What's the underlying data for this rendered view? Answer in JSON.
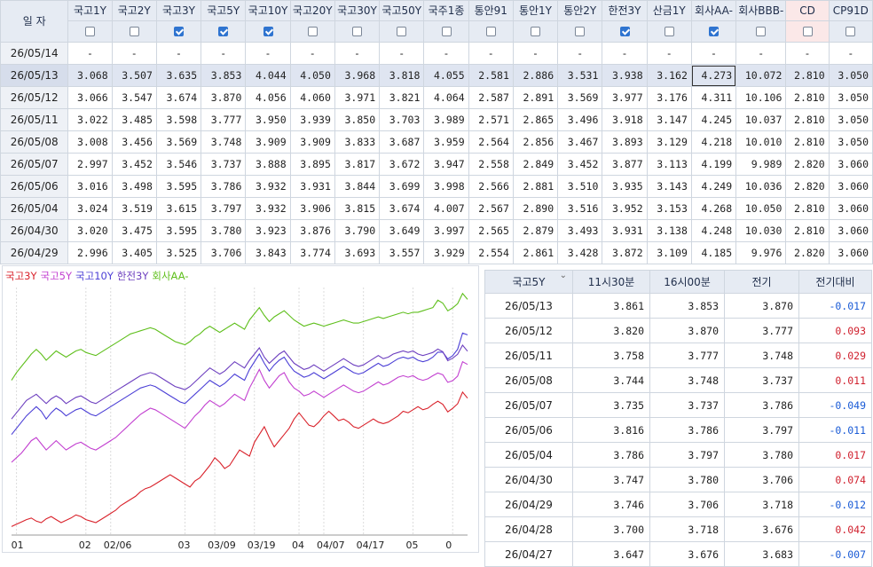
{
  "top_table": {
    "date_header": "일    자",
    "columns": [
      {
        "label": "국고1Y",
        "checked": false
      },
      {
        "label": "국고2Y",
        "checked": false
      },
      {
        "label": "국고3Y",
        "checked": true
      },
      {
        "label": "국고5Y",
        "checked": true
      },
      {
        "label": "국고10Y",
        "checked": true
      },
      {
        "label": "국고20Y",
        "checked": false
      },
      {
        "label": "국고30Y",
        "checked": false
      },
      {
        "label": "국고50Y",
        "checked": false
      },
      {
        "label": "국주1종",
        "checked": false
      },
      {
        "label": "통안91",
        "checked": false
      },
      {
        "label": "통안1Y",
        "checked": false
      },
      {
        "label": "통안2Y",
        "checked": false
      },
      {
        "label": "한전3Y",
        "checked": true
      },
      {
        "label": "산금1Y",
        "checked": false
      },
      {
        "label": "회사AA-",
        "checked": true
      },
      {
        "label": "회사BBB-",
        "checked": false
      },
      {
        "label": "CD",
        "checked": false
      },
      {
        "label": "CP91D",
        "checked": false
      }
    ],
    "rows": [
      {
        "date": "26/05/14",
        "values": [
          "-",
          "-",
          "-",
          "-",
          "-",
          "-",
          "-",
          "-",
          "-",
          "-",
          "-",
          "-",
          "-",
          "-",
          "-",
          "-",
          "-",
          "-"
        ]
      },
      {
        "date": "26/05/13",
        "values": [
          "3.068",
          "3.507",
          "3.635",
          "3.853",
          "4.044",
          "4.050",
          "3.968",
          "3.818",
          "4.055",
          "2.581",
          "2.886",
          "3.531",
          "3.938",
          "3.162",
          "4.273",
          "10.072",
          "2.810",
          "3.050"
        ]
      },
      {
        "date": "26/05/12",
        "values": [
          "3.066",
          "3.547",
          "3.674",
          "3.870",
          "4.056",
          "4.060",
          "3.971",
          "3.821",
          "4.064",
          "2.587",
          "2.891",
          "3.569",
          "3.977",
          "3.176",
          "4.311",
          "10.106",
          "2.810",
          "3.050"
        ]
      },
      {
        "date": "26/05/11",
        "values": [
          "3.022",
          "3.485",
          "3.598",
          "3.777",
          "3.950",
          "3.939",
          "3.850",
          "3.703",
          "3.989",
          "2.571",
          "2.865",
          "3.496",
          "3.918",
          "3.147",
          "4.245",
          "10.037",
          "2.810",
          "3.050"
        ]
      },
      {
        "date": "26/05/08",
        "values": [
          "3.008",
          "3.456",
          "3.569",
          "3.748",
          "3.909",
          "3.909",
          "3.833",
          "3.687",
          "3.959",
          "2.564",
          "2.856",
          "3.467",
          "3.893",
          "3.129",
          "4.218",
          "10.010",
          "2.810",
          "3.050"
        ]
      },
      {
        "date": "26/05/07",
        "values": [
          "2.997",
          "3.452",
          "3.546",
          "3.737",
          "3.888",
          "3.895",
          "3.817",
          "3.672",
          "3.947",
          "2.558",
          "2.849",
          "3.452",
          "3.877",
          "3.113",
          "4.199",
          "9.989",
          "2.820",
          "3.060"
        ]
      },
      {
        "date": "26/05/06",
        "values": [
          "3.016",
          "3.498",
          "3.595",
          "3.786",
          "3.932",
          "3.931",
          "3.844",
          "3.699",
          "3.998",
          "2.566",
          "2.881",
          "3.510",
          "3.935",
          "3.143",
          "4.249",
          "10.036",
          "2.820",
          "3.060"
        ]
      },
      {
        "date": "26/05/04",
        "values": [
          "3.024",
          "3.519",
          "3.615",
          "3.797",
          "3.932",
          "3.906",
          "3.815",
          "3.674",
          "4.007",
          "2.567",
          "2.890",
          "3.516",
          "3.952",
          "3.153",
          "4.268",
          "10.050",
          "2.810",
          "3.060"
        ]
      },
      {
        "date": "26/04/30",
        "values": [
          "3.020",
          "3.475",
          "3.595",
          "3.780",
          "3.923",
          "3.876",
          "3.790",
          "3.649",
          "3.997",
          "2.565",
          "2.879",
          "3.493",
          "3.931",
          "3.138",
          "4.248",
          "10.030",
          "2.810",
          "3.060"
        ]
      },
      {
        "date": "26/04/29",
        "values": [
          "2.996",
          "3.405",
          "3.525",
          "3.706",
          "3.843",
          "3.774",
          "3.693",
          "3.557",
          "3.929",
          "2.554",
          "2.861",
          "3.428",
          "3.872",
          "3.109",
          "4.185",
          "9.976",
          "2.820",
          "3.060"
        ]
      }
    ]
  },
  "chart": {
    "legend": [
      {
        "name": "국고3Y",
        "color": "#d9222b"
      },
      {
        "name": "국고5Y",
        "color": "#c23fd0"
      },
      {
        "name": "국고10Y",
        "color": "#4b3fd6"
      },
      {
        "name": "한전3Y",
        "color": "#6d3fbf"
      },
      {
        "name": "회사AA-",
        "color": "#5fbf1c"
      }
    ],
    "x_labels": [
      {
        "label": "01",
        "i": 1
      },
      {
        "label": "02",
        "i": 15
      },
      {
        "label": "02/06",
        "i": 20
      },
      {
        "label": "03",
        "i": 35
      },
      {
        "label": "03/09",
        "i": 41
      },
      {
        "label": "03/19",
        "i": 49
      },
      {
        "label": "04",
        "i": 58
      },
      {
        "label": "04/07",
        "i": 63
      },
      {
        "label": "04/17",
        "i": 71
      },
      {
        "label": "05",
        "i": 81
      },
      {
        "label": "0",
        "i": 89
      }
    ]
  },
  "chart_data": {
    "type": "line",
    "xlabel": "",
    "ylabel": "",
    "ylim": [
      2.75,
      4.35
    ],
    "series": [
      {
        "name": "국고3Y",
        "values": [
          2.805,
          2.82,
          2.835,
          2.85,
          2.86,
          2.84,
          2.83,
          2.855,
          2.87,
          2.85,
          2.83,
          2.845,
          2.86,
          2.88,
          2.87,
          2.85,
          2.84,
          2.83,
          2.85,
          2.87,
          2.89,
          2.91,
          2.94,
          2.96,
          2.98,
          3.0,
          3.03,
          3.05,
          3.06,
          3.08,
          3.1,
          3.12,
          3.14,
          3.12,
          3.1,
          3.08,
          3.06,
          3.1,
          3.12,
          3.16,
          3.2,
          3.25,
          3.22,
          3.18,
          3.2,
          3.25,
          3.3,
          3.28,
          3.26,
          3.35,
          3.4,
          3.45,
          3.38,
          3.32,
          3.36,
          3.4,
          3.44,
          3.5,
          3.54,
          3.5,
          3.46,
          3.45,
          3.48,
          3.52,
          3.55,
          3.52,
          3.49,
          3.5,
          3.48,
          3.45,
          3.44,
          3.46,
          3.48,
          3.5,
          3.48,
          3.47,
          3.48,
          3.5,
          3.52,
          3.55,
          3.54,
          3.56,
          3.58,
          3.56,
          3.57,
          3.595,
          3.615,
          3.595,
          3.546,
          3.569,
          3.598,
          3.674,
          3.635
        ]
      },
      {
        "name": "국고5Y",
        "values": [
          3.22,
          3.25,
          3.28,
          3.32,
          3.36,
          3.38,
          3.34,
          3.3,
          3.33,
          3.36,
          3.33,
          3.3,
          3.32,
          3.34,
          3.35,
          3.33,
          3.31,
          3.3,
          3.32,
          3.34,
          3.36,
          3.38,
          3.41,
          3.44,
          3.47,
          3.5,
          3.53,
          3.55,
          3.57,
          3.56,
          3.54,
          3.52,
          3.5,
          3.48,
          3.46,
          3.44,
          3.48,
          3.52,
          3.55,
          3.59,
          3.62,
          3.6,
          3.58,
          3.6,
          3.63,
          3.66,
          3.64,
          3.62,
          3.7,
          3.76,
          3.82,
          3.75,
          3.7,
          3.74,
          3.78,
          3.8,
          3.74,
          3.7,
          3.68,
          3.65,
          3.66,
          3.68,
          3.66,
          3.64,
          3.66,
          3.68,
          3.7,
          3.72,
          3.7,
          3.68,
          3.67,
          3.68,
          3.7,
          3.72,
          3.74,
          3.72,
          3.73,
          3.75,
          3.77,
          3.78,
          3.77,
          3.78,
          3.76,
          3.75,
          3.76,
          3.78,
          3.797,
          3.786,
          3.737,
          3.748,
          3.777,
          3.87,
          3.853
        ]
      },
      {
        "name": "국고10Y",
        "values": [
          3.4,
          3.44,
          3.48,
          3.52,
          3.55,
          3.58,
          3.55,
          3.5,
          3.54,
          3.57,
          3.55,
          3.52,
          3.54,
          3.56,
          3.57,
          3.55,
          3.53,
          3.52,
          3.54,
          3.56,
          3.58,
          3.6,
          3.62,
          3.64,
          3.66,
          3.68,
          3.7,
          3.71,
          3.72,
          3.71,
          3.69,
          3.67,
          3.65,
          3.63,
          3.61,
          3.6,
          3.63,
          3.66,
          3.69,
          3.72,
          3.75,
          3.73,
          3.71,
          3.73,
          3.76,
          3.79,
          3.77,
          3.75,
          3.82,
          3.87,
          3.92,
          3.86,
          3.81,
          3.85,
          3.88,
          3.9,
          3.85,
          3.81,
          3.79,
          3.77,
          3.78,
          3.8,
          3.78,
          3.76,
          3.78,
          3.8,
          3.82,
          3.84,
          3.82,
          3.8,
          3.79,
          3.8,
          3.82,
          3.84,
          3.86,
          3.84,
          3.85,
          3.87,
          3.89,
          3.9,
          3.89,
          3.9,
          3.88,
          3.87,
          3.88,
          3.9,
          3.932,
          3.932,
          3.888,
          3.909,
          3.95,
          4.056,
          4.044
        ]
      },
      {
        "name": "한전3Y",
        "values": [
          3.5,
          3.54,
          3.58,
          3.62,
          3.64,
          3.66,
          3.63,
          3.6,
          3.63,
          3.65,
          3.63,
          3.6,
          3.62,
          3.64,
          3.65,
          3.63,
          3.61,
          3.6,
          3.62,
          3.64,
          3.66,
          3.68,
          3.7,
          3.72,
          3.74,
          3.76,
          3.78,
          3.79,
          3.8,
          3.79,
          3.77,
          3.75,
          3.73,
          3.71,
          3.7,
          3.69,
          3.71,
          3.74,
          3.77,
          3.8,
          3.83,
          3.81,
          3.79,
          3.81,
          3.84,
          3.87,
          3.85,
          3.83,
          3.88,
          3.92,
          3.96,
          3.9,
          3.86,
          3.89,
          3.92,
          3.94,
          3.9,
          3.86,
          3.84,
          3.82,
          3.83,
          3.85,
          3.83,
          3.81,
          3.83,
          3.85,
          3.87,
          3.89,
          3.87,
          3.85,
          3.84,
          3.85,
          3.87,
          3.89,
          3.91,
          3.89,
          3.9,
          3.92,
          3.93,
          3.94,
          3.93,
          3.94,
          3.92,
          3.91,
          3.92,
          3.93,
          3.952,
          3.935,
          3.877,
          3.893,
          3.918,
          3.977,
          3.938
        ]
      },
      {
        "name": "회사AA-",
        "values": [
          3.75,
          3.8,
          3.84,
          3.88,
          3.92,
          3.95,
          3.92,
          3.88,
          3.91,
          3.94,
          3.92,
          3.9,
          3.92,
          3.94,
          3.95,
          3.93,
          3.92,
          3.91,
          3.93,
          3.95,
          3.97,
          3.99,
          4.01,
          4.03,
          4.05,
          4.06,
          4.07,
          4.08,
          4.09,
          4.08,
          4.06,
          4.04,
          4.02,
          4.0,
          3.99,
          3.98,
          4.0,
          4.03,
          4.05,
          4.08,
          4.1,
          4.08,
          4.06,
          4.08,
          4.1,
          4.12,
          4.1,
          4.08,
          4.14,
          4.18,
          4.22,
          4.17,
          4.13,
          4.16,
          4.18,
          4.2,
          4.17,
          4.14,
          4.12,
          4.1,
          4.11,
          4.12,
          4.11,
          4.1,
          4.11,
          4.12,
          4.13,
          4.14,
          4.13,
          4.12,
          4.12,
          4.13,
          4.14,
          4.15,
          4.16,
          4.15,
          4.16,
          4.17,
          4.18,
          4.19,
          4.18,
          4.19,
          4.19,
          4.2,
          4.21,
          4.22,
          4.268,
          4.249,
          4.199,
          4.218,
          4.245,
          4.311,
          4.273
        ]
      }
    ]
  },
  "side_table": {
    "selector": "국고5Y",
    "headers": [
      "11시30분",
      "16시00분",
      "전기",
      "전기대비"
    ],
    "rows": [
      {
        "date": "26/05/13",
        "a": "3.861",
        "b": "3.853",
        "c": "3.870",
        "d": "-0.017",
        "sign": "neg"
      },
      {
        "date": "26/05/12",
        "a": "3.820",
        "b": "3.870",
        "c": "3.777",
        "d": "0.093",
        "sign": "pos"
      },
      {
        "date": "26/05/11",
        "a": "3.758",
        "b": "3.777",
        "c": "3.748",
        "d": "0.029",
        "sign": "pos"
      },
      {
        "date": "26/05/08",
        "a": "3.744",
        "b": "3.748",
        "c": "3.737",
        "d": "0.011",
        "sign": "pos"
      },
      {
        "date": "26/05/07",
        "a": "3.735",
        "b": "3.737",
        "c": "3.786",
        "d": "-0.049",
        "sign": "neg"
      },
      {
        "date": "26/05/06",
        "a": "3.816",
        "b": "3.786",
        "c": "3.797",
        "d": "-0.011",
        "sign": "neg"
      },
      {
        "date": "26/05/04",
        "a": "3.786",
        "b": "3.797",
        "c": "3.780",
        "d": "0.017",
        "sign": "pos"
      },
      {
        "date": "26/04/30",
        "a": "3.747",
        "b": "3.780",
        "c": "3.706",
        "d": "0.074",
        "sign": "pos"
      },
      {
        "date": "26/04/29",
        "a": "3.746",
        "b": "3.706",
        "c": "3.718",
        "d": "-0.012",
        "sign": "neg"
      },
      {
        "date": "26/04/28",
        "a": "3.700",
        "b": "3.718",
        "c": "3.676",
        "d": "0.042",
        "sign": "pos"
      },
      {
        "date": "26/04/27",
        "a": "3.647",
        "b": "3.676",
        "c": "3.683",
        "d": "-0.007",
        "sign": "neg"
      }
    ]
  }
}
